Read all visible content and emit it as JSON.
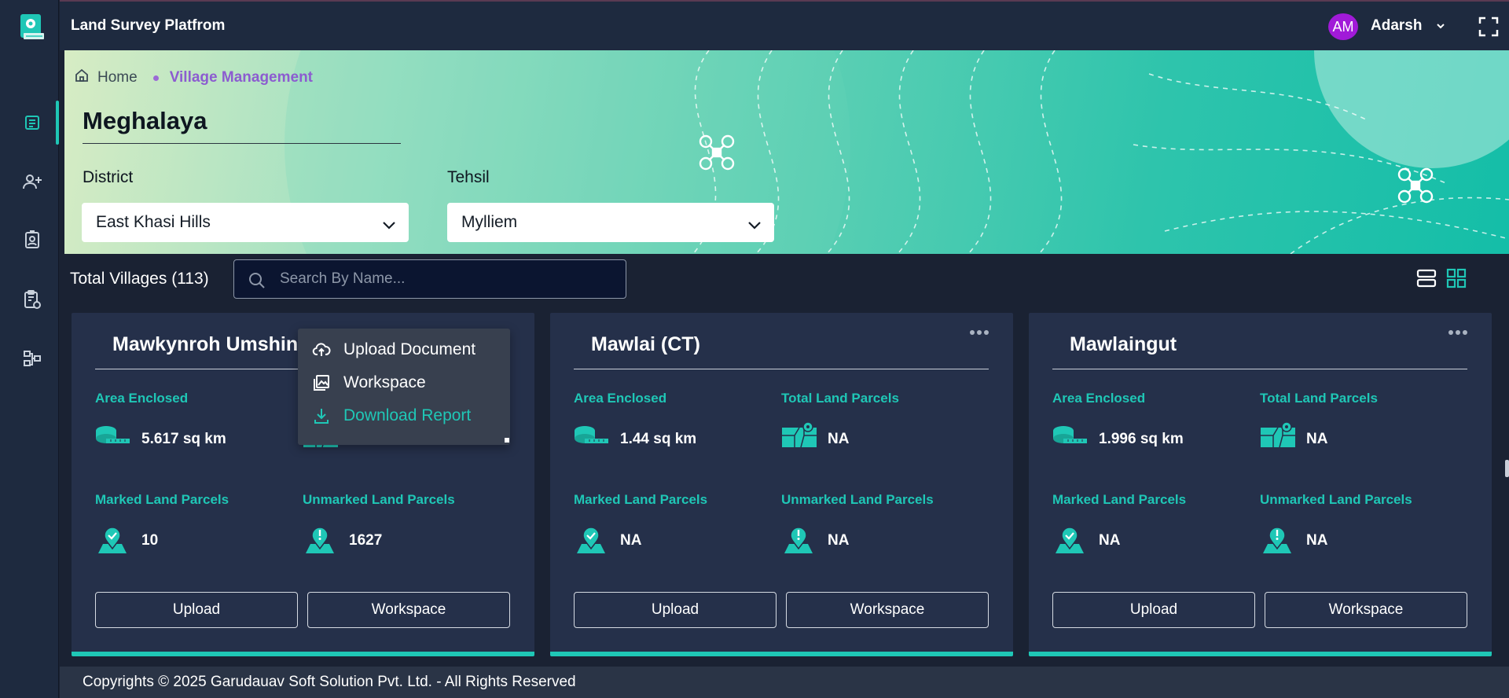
{
  "app": {
    "title": "Land Survey Platfrom"
  },
  "user": {
    "initials": "AM",
    "name": "Adarsh"
  },
  "breadcrumb": {
    "home": "Home",
    "current": "Village Management"
  },
  "state": {
    "name": "Meghalaya"
  },
  "filters": {
    "district_label": "District",
    "district_value": "East Khasi Hills",
    "tehsil_label": "Tehsil",
    "tehsil_value": "Mylliem"
  },
  "toolbar": {
    "total_label": "Total Villages (113)",
    "search_placeholder": "Search By Name..."
  },
  "card_labels": {
    "area": "Area Enclosed",
    "total_parcels": "Total Land Parcels",
    "marked": "Marked Land Parcels",
    "unmarked": "Unmarked Land Parcels",
    "upload_btn": "Upload",
    "workspace_btn": "Workspace"
  },
  "cards": [
    {
      "name": "Mawkynroh Umshing",
      "area": "5.617 sq km",
      "total_parcels": "",
      "marked": "10",
      "unmarked": "1627"
    },
    {
      "name": "Mawlai (CT)",
      "area": "1.44 sq km",
      "total_parcels": "NA",
      "marked": "NA",
      "unmarked": "NA"
    },
    {
      "name": "Mawlaingut",
      "area": "1.996 sq km",
      "total_parcels": "NA",
      "marked": "NA",
      "unmarked": "NA"
    }
  ],
  "menu": {
    "upload_document": "Upload Document",
    "workspace": "Workspace",
    "download_report": "Download Report"
  },
  "footer": {
    "text": "Copyrights © 2025 Garudauav Soft Solution Pvt. Ltd. - All Rights Reserved"
  },
  "colors": {
    "accent": "#1fc7b6",
    "avatar": "#a11ad8",
    "breadcrumb_active": "#8c5cd0"
  },
  "icons": {
    "sidebar": [
      "document-list-icon",
      "add-user-icon",
      "id-badge-icon",
      "clipboard-settings-icon",
      "hierarchy-icon"
    ],
    "stats": [
      "measuring-tape-icon",
      "parcel-map-icon",
      "marked-pin-icon",
      "unmarked-pin-icon"
    ]
  }
}
